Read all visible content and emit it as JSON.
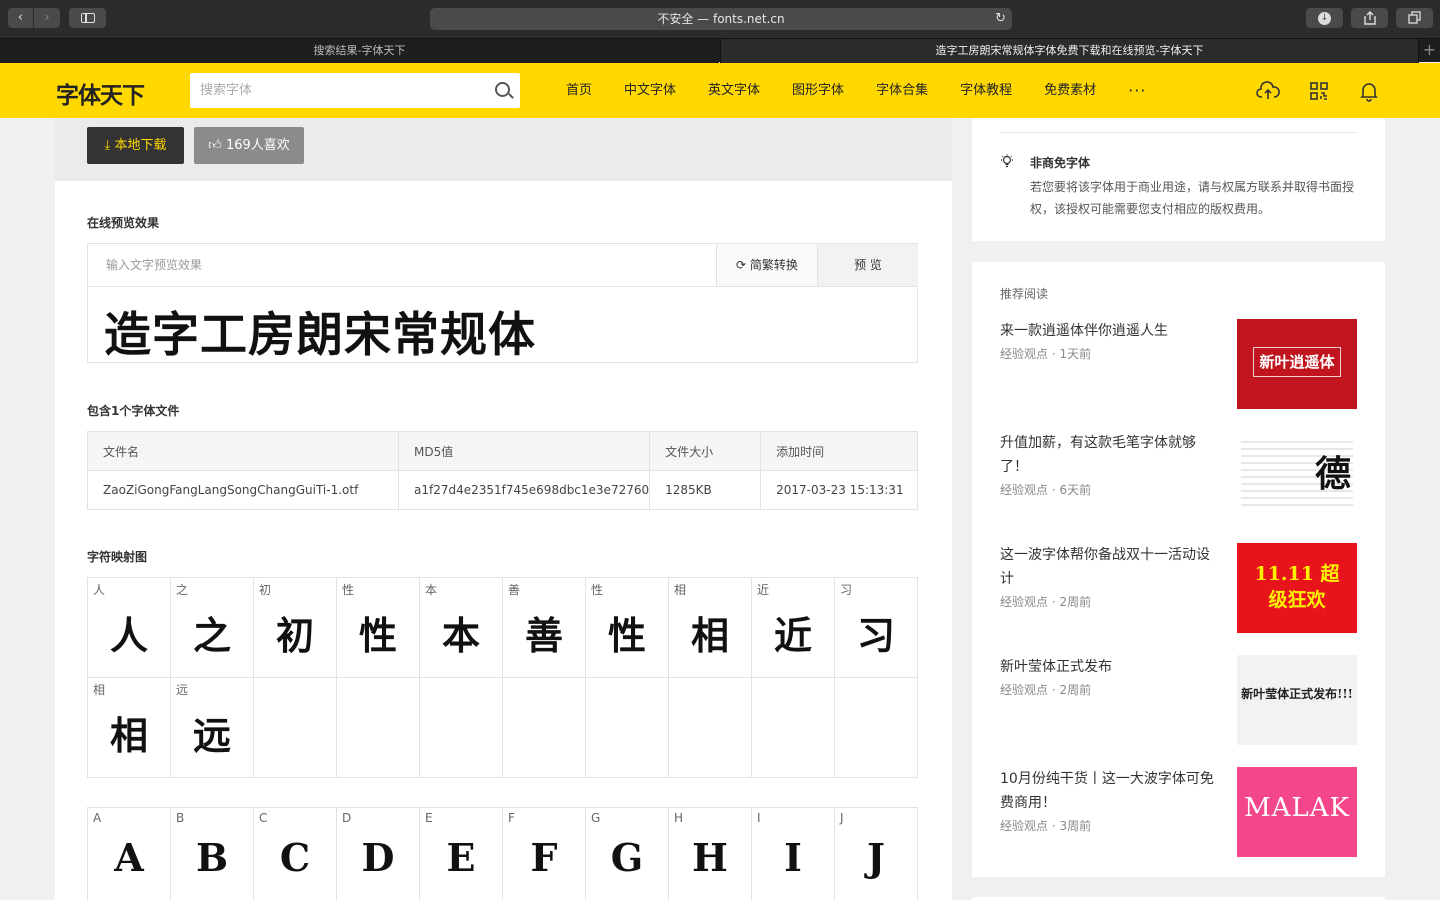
{
  "browser": {
    "address": "不安全 — fonts.net.cn",
    "tabs": [
      "搜索结果-字体天下",
      "造字工房朗宋常规体字体免费下载和在线预览-字体天下"
    ]
  },
  "header": {
    "logo": "字体天下",
    "search_placeholder": "搜索字体",
    "menu": [
      "首页",
      "中文字体",
      "英文字体",
      "图形字体",
      "字体合集",
      "字体教程",
      "免费素材",
      "···"
    ]
  },
  "main": {
    "download_label": "本地下载",
    "like_label": "169人喜欢",
    "preview_title": "在线预览效果",
    "preview_placeholder": "输入文字预览效果",
    "convert_label": "简繁转换",
    "preview_button": "预 览",
    "preview_text": "造字工房朗宋常规体",
    "files_title": "包含1个字体文件",
    "file_table": {
      "headers": [
        "文件名",
        "MD5值",
        "文件大小",
        "添加时间"
      ],
      "rows": [
        [
          "ZaoZiGongFangLangSongChangGuiTi-1.otf",
          "a1f27d4e2351f745e698dbc1e3e72760",
          "1285KB",
          "2017-03-23 15:13:31"
        ]
      ]
    },
    "charmap_title": "字符映射图",
    "glyphs_cn": [
      "人",
      "之",
      "初",
      "性",
      "本",
      "善",
      "性",
      "相",
      "近",
      "习",
      "相",
      "远"
    ],
    "glyphs_en": [
      "A",
      "B",
      "C",
      "D",
      "E",
      "F",
      "G",
      "H",
      "I",
      "J"
    ]
  },
  "sidebar": {
    "notice_title": "非商免字体",
    "notice_desc": "若您要将该字体用于商业用途，请与权属方联系并取得书面授权，该授权可能需要您支付相应的版权费用。",
    "rec_title": "推荐阅读",
    "rec_items": [
      {
        "title": "来一款逍遥体伴你逍遥人生",
        "category": "经验观点",
        "time": "1天前",
        "thumb_text": "新叶逍遥体",
        "thumb_bg": "#c0141e"
      },
      {
        "title": "升值加薪，有这款毛笔字体就够了！",
        "category": "经验观点",
        "time": "6天前",
        "thumb_text": "德",
        "thumb_bg": "#ffffff"
      },
      {
        "title": "这一波字体帮你备战双十一活动设计",
        "category": "经验观点",
        "time": "2周前",
        "thumb_text": "11.11 超级狂欢",
        "thumb_bg": "#e8141c"
      },
      {
        "title": "新叶莹体正式发布",
        "category": "经验观点",
        "time": "2周前",
        "thumb_text": "新叶莹体正式发布!!!",
        "thumb_bg": "#f2f2f2"
      },
      {
        "title": "10月份纯干货丨这一大波字体可免费商用！",
        "category": "经验观点",
        "time": "3周前",
        "thumb_text": "MALAK",
        "thumb_bg": "#f4468a"
      }
    ]
  },
  "colors": {
    "brand": "#ffd800",
    "dark": "#333333"
  }
}
